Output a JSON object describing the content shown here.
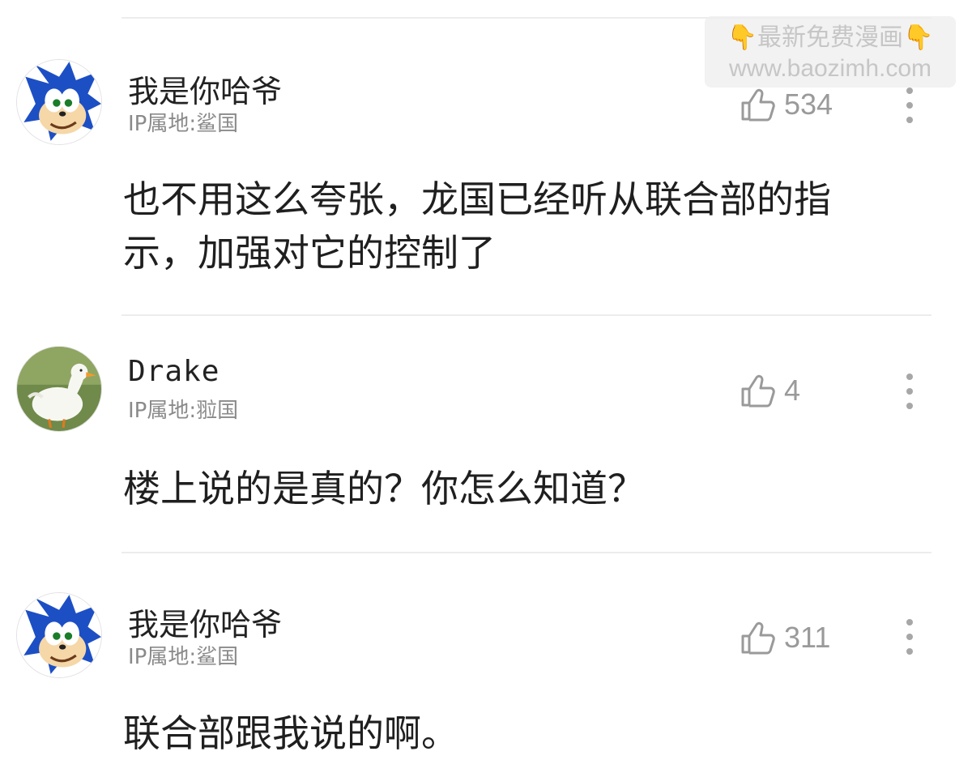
{
  "watermark": {
    "line1_left_emoji": "👇",
    "line1_text": "最新免费漫画",
    "line1_right_emoji": "👇",
    "line2": "www.baozimh.com"
  },
  "comments": [
    {
      "username": "我是你哈爷",
      "ip": "IP属地:鲨国",
      "likes": "534",
      "text": "也不用这么夸张，龙国已经听从联合部的指示，加强对它的控制了",
      "avatar_icon": "sonic-avatar-icon"
    },
    {
      "username": "Drake",
      "ip": "IP属地:翋国",
      "likes": "4",
      "text": "楼上说的是真的？你怎么知道？",
      "avatar_icon": "duck-avatar-icon"
    },
    {
      "username": "我是你哈爷",
      "ip": "IP属地:鲨国",
      "likes": "311",
      "text": "联合部跟我说的啊。",
      "avatar_icon": "sonic-avatar-icon"
    }
  ],
  "colors": {
    "like_icon": "#9a9a9a",
    "more_dots": "#a7a7a7",
    "divider": "#ececec"
  }
}
